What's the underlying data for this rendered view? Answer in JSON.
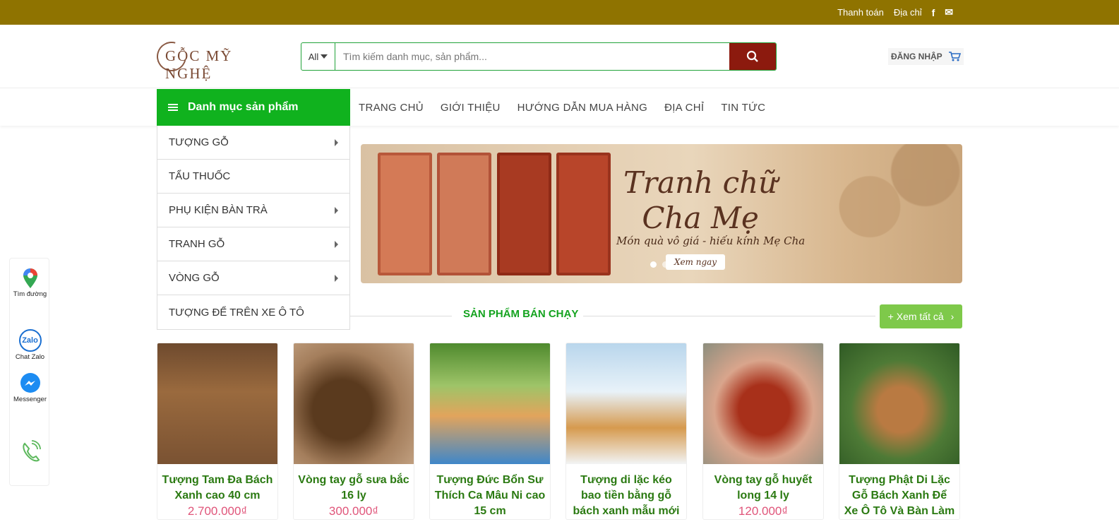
{
  "topbar": {
    "payment_link": "Thanh toán",
    "address_link": "Địa chỉ",
    "facebook_icon": "f",
    "mail_icon": "✉"
  },
  "header": {
    "logo_text": "GỖC MỸ NGHỆ",
    "search_category": "All",
    "search_placeholder": "Tìm kiếm danh mục, sản phẩm...",
    "login_label": "ĐĂNG NHẬP"
  },
  "nav": {
    "category_button": "Danh mục sản phẩm",
    "menu": [
      "TRANG CHỦ",
      "GIỚI THIỆU",
      "HƯỚNG DẪN MUA HÀNG",
      "ĐỊA CHỈ",
      "TIN TỨC"
    ]
  },
  "sidebar": {
    "items": [
      {
        "label": "TƯỢNG GỖ",
        "has_sub": true
      },
      {
        "label": "TẨU THUỐC",
        "has_sub": false
      },
      {
        "label": "PHỤ KIỆN BÀN TRÀ",
        "has_sub": true
      },
      {
        "label": "TRANH GỖ",
        "has_sub": true
      },
      {
        "label": "VÒNG GỖ",
        "has_sub": true
      },
      {
        "label": "TƯỢNG ĐỂ TRÊN XE Ô TÔ",
        "has_sub": false
      }
    ]
  },
  "banner": {
    "title_line1": "Tranh chữ",
    "title_line2": "Cha Mẹ",
    "subtitle": "Món quà vô giá - hiếu kính Mẹ Cha",
    "button": "Xem ngay"
  },
  "section": {
    "title": "SẢN PHẨM BÁN CHẠY",
    "see_all": "+ Xem tất cả"
  },
  "products": [
    {
      "name": "Tượng Tam Đa Bách Xanh cao 40 cm",
      "price": "2.700.000₫"
    },
    {
      "name": "Vòng tay gỗ sưa bắc 16 ly",
      "price": "300.000₫"
    },
    {
      "name": "Tượng Đức Bổn Sư Thích Ca Mâu Ni cao 15 cm",
      "price": ""
    },
    {
      "name": "Tượng di lặc kéo bao tiền bằng gỗ bách xanh mẫu mới",
      "price": ""
    },
    {
      "name": "Vòng tay gỗ huyết long 14 ly",
      "price": "120.000₫"
    },
    {
      "name": "Tượng Phật Di Lặc Gỗ Bách Xanh Để Xe Ô Tô Và Bàn Làm",
      "price": ""
    }
  ],
  "floating": {
    "directions": "Tìm đường",
    "zalo": "Chat Zalo",
    "zalo_logo": "Zalo",
    "messenger": "Messenger"
  },
  "colors": {
    "topbar": "#8f7300",
    "green": "#10b21e",
    "search_button": "#8c1a0e",
    "price": "#e0557a"
  }
}
